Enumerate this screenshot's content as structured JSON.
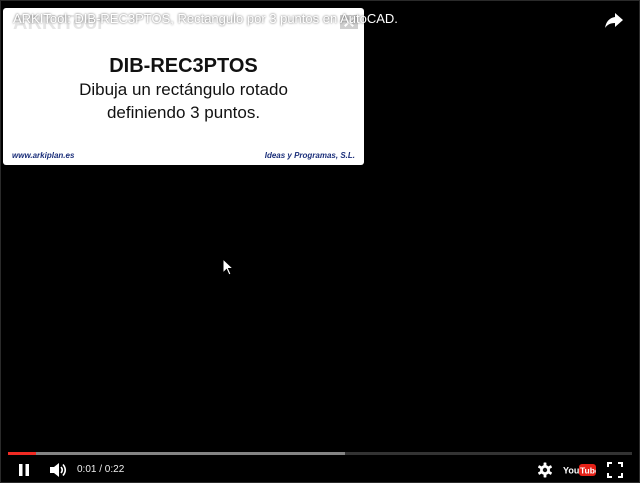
{
  "video": {
    "title": "ARKITool: DIB-REC3PTOS, Rectangulo por 3 puntos en AutoCAD."
  },
  "card": {
    "ghost_text": "ARKITool",
    "heading": "DIB-REC3PTOS",
    "line1": "Dibuja un rectángulo rotado",
    "line2": "definiendo 3 puntos.",
    "url": "www.arkiplan.es",
    "company": "Ideas y Programas, S.L."
  },
  "controls": {
    "time": "0:01 / 0:22",
    "played_fraction": 0.045,
    "buffered_fraction": 0.54,
    "logo_text": "YouTube",
    "icons": [
      "share-icon",
      "pause-icon",
      "volume-icon",
      "settings-icon",
      "youtube-logo",
      "fullscreen-icon"
    ]
  },
  "colors": {
    "progress_played": "#f12b24",
    "logo_red": "#e62117",
    "card_link": "#1b2f7a"
  }
}
